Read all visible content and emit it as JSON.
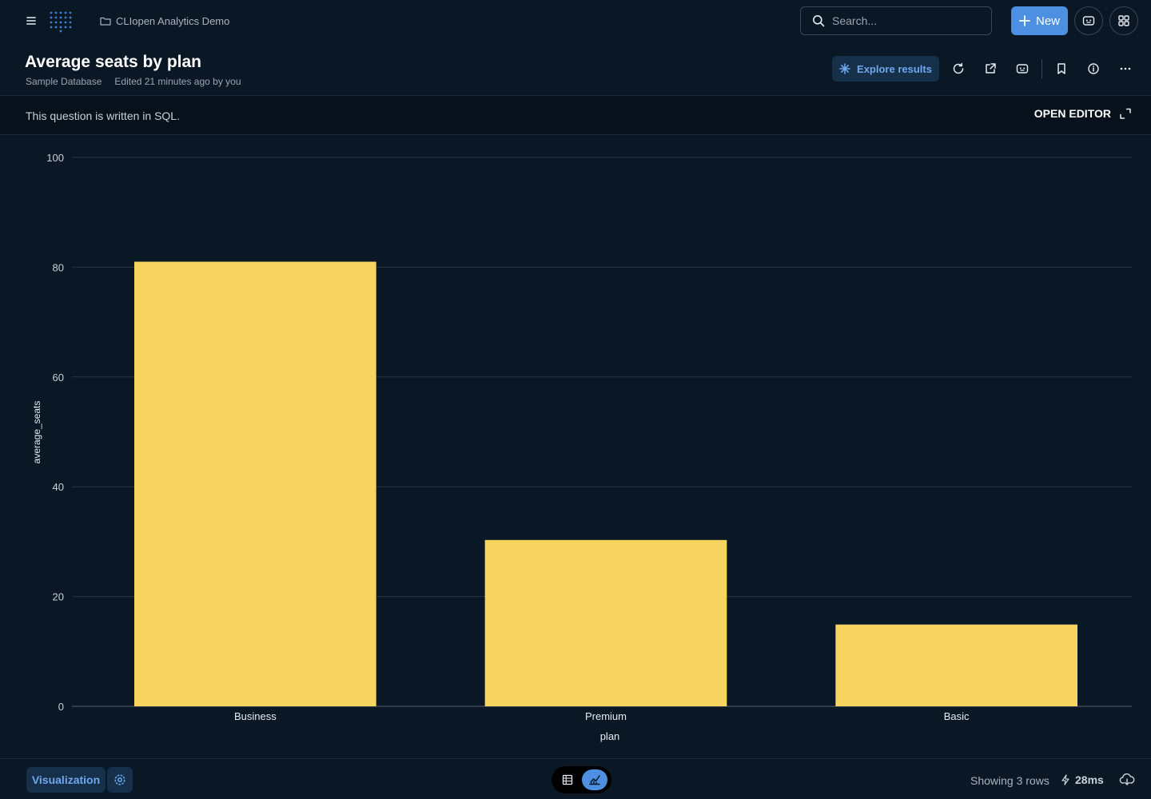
{
  "topbar": {
    "collection": "CLIopen Analytics Demo",
    "search_placeholder": "Search...",
    "new_label": "New"
  },
  "header": {
    "title": "Average seats by plan",
    "database": "Sample Database",
    "edited": "Edited 21 minutes ago by you",
    "explore_label": "Explore results"
  },
  "sql_bar": {
    "text": "This question is written in SQL.",
    "open_editor_label": "OPEN EDITOR"
  },
  "chart_data": {
    "type": "bar",
    "categories": [
      "Business",
      "Premium",
      "Basic"
    ],
    "values": [
      81,
      30.3,
      14.9
    ],
    "xlabel": "plan",
    "ylabel": "average_seats",
    "ylim": [
      0,
      100
    ],
    "yticks": [
      0,
      20,
      40,
      60,
      80,
      100
    ],
    "bar_color": "#f7d35f",
    "grid": true
  },
  "footer": {
    "visualization_label": "Visualization",
    "rows_text": "Showing 3 rows",
    "timing": "28ms"
  },
  "colors": {
    "background": "#0a1724",
    "accent": "#4d8fe0",
    "bar": "#f7d35f"
  }
}
